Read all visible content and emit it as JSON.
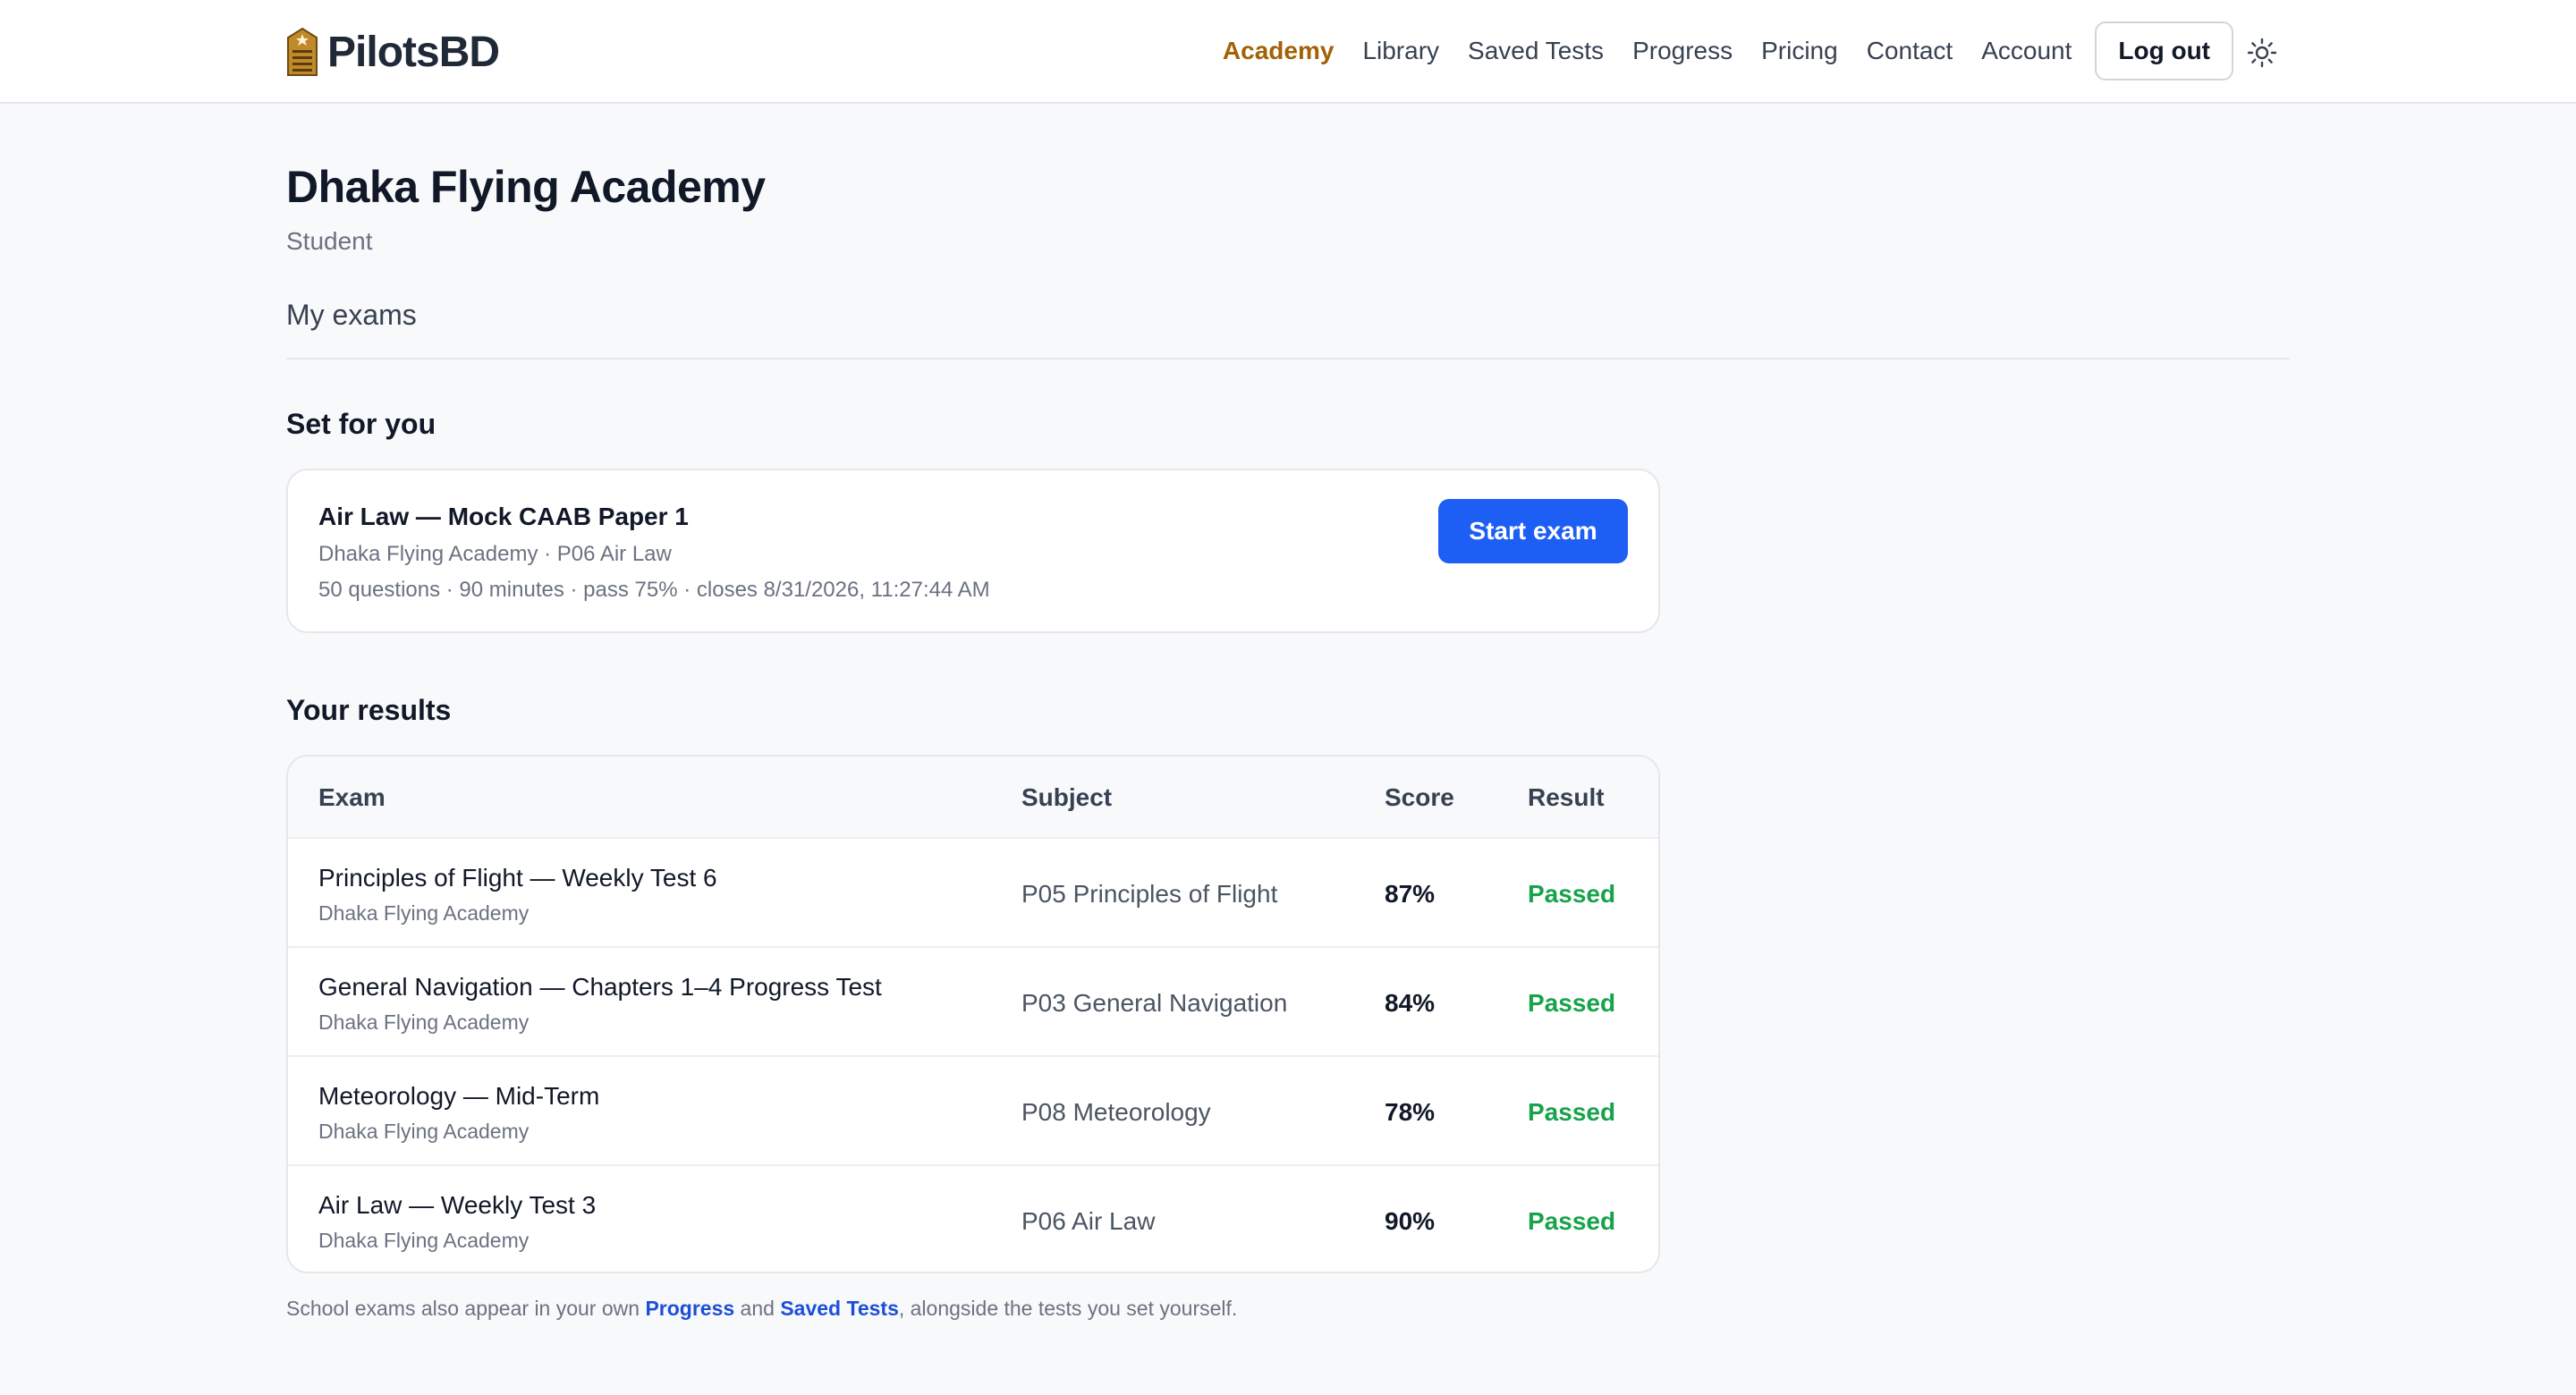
{
  "brand": {
    "name": "PilotsBD",
    "logo_icon": "building-icon"
  },
  "nav": {
    "items": [
      {
        "label": "Academy",
        "active": true
      },
      {
        "label": "Library",
        "active": false
      },
      {
        "label": "Saved Tests",
        "active": false
      },
      {
        "label": "Progress",
        "active": false
      },
      {
        "label": "Pricing",
        "active": false
      },
      {
        "label": "Contact",
        "active": false
      },
      {
        "label": "Account",
        "active": false
      }
    ],
    "logout_label": "Log out",
    "theme_icon": "sun-icon"
  },
  "page": {
    "title": "Dhaka Flying Academy",
    "role": "Student",
    "tab": "My exams"
  },
  "assigned": {
    "heading": "Set for you",
    "exams": [
      {
        "title": "Air Law — Mock CAAB Paper 1",
        "subtitle": "Dhaka Flying Academy · P06 Air Law",
        "meta": "50 questions · 90 minutes · pass 75% · closes 8/31/2026, 11:27:44 AM",
        "button": "Start exam"
      }
    ]
  },
  "results": {
    "heading": "Your results",
    "columns": [
      "Exam",
      "Subject",
      "Score",
      "Result"
    ],
    "rows": [
      {
        "exam": "Principles of Flight — Weekly Test 6",
        "school": "Dhaka Flying Academy",
        "subject": "P05 Principles of Flight",
        "score": "87%",
        "result": "Passed"
      },
      {
        "exam": "General Navigation — Chapters 1–4 Progress Test",
        "school": "Dhaka Flying Academy",
        "subject": "P03 General Navigation",
        "score": "84%",
        "result": "Passed"
      },
      {
        "exam": "Meteorology — Mid-Term",
        "school": "Dhaka Flying Academy",
        "subject": "P08 Meteorology",
        "score": "78%",
        "result": "Passed"
      },
      {
        "exam": "Air Law — Weekly Test 3",
        "school": "Dhaka Flying Academy",
        "subject": "P06 Air Law",
        "score": "90%",
        "result": "Passed"
      }
    ]
  },
  "footnote": {
    "prefix": "School exams also appear in your own ",
    "link1": "Progress",
    "middle": " and ",
    "link2": "Saved Tests",
    "suffix": ", alongside the tests you set yourself."
  },
  "colors": {
    "accent_active": "#a16207",
    "primary_button": "#1d5ff5",
    "passed": "#16a34a",
    "link": "#1d4ed8"
  }
}
